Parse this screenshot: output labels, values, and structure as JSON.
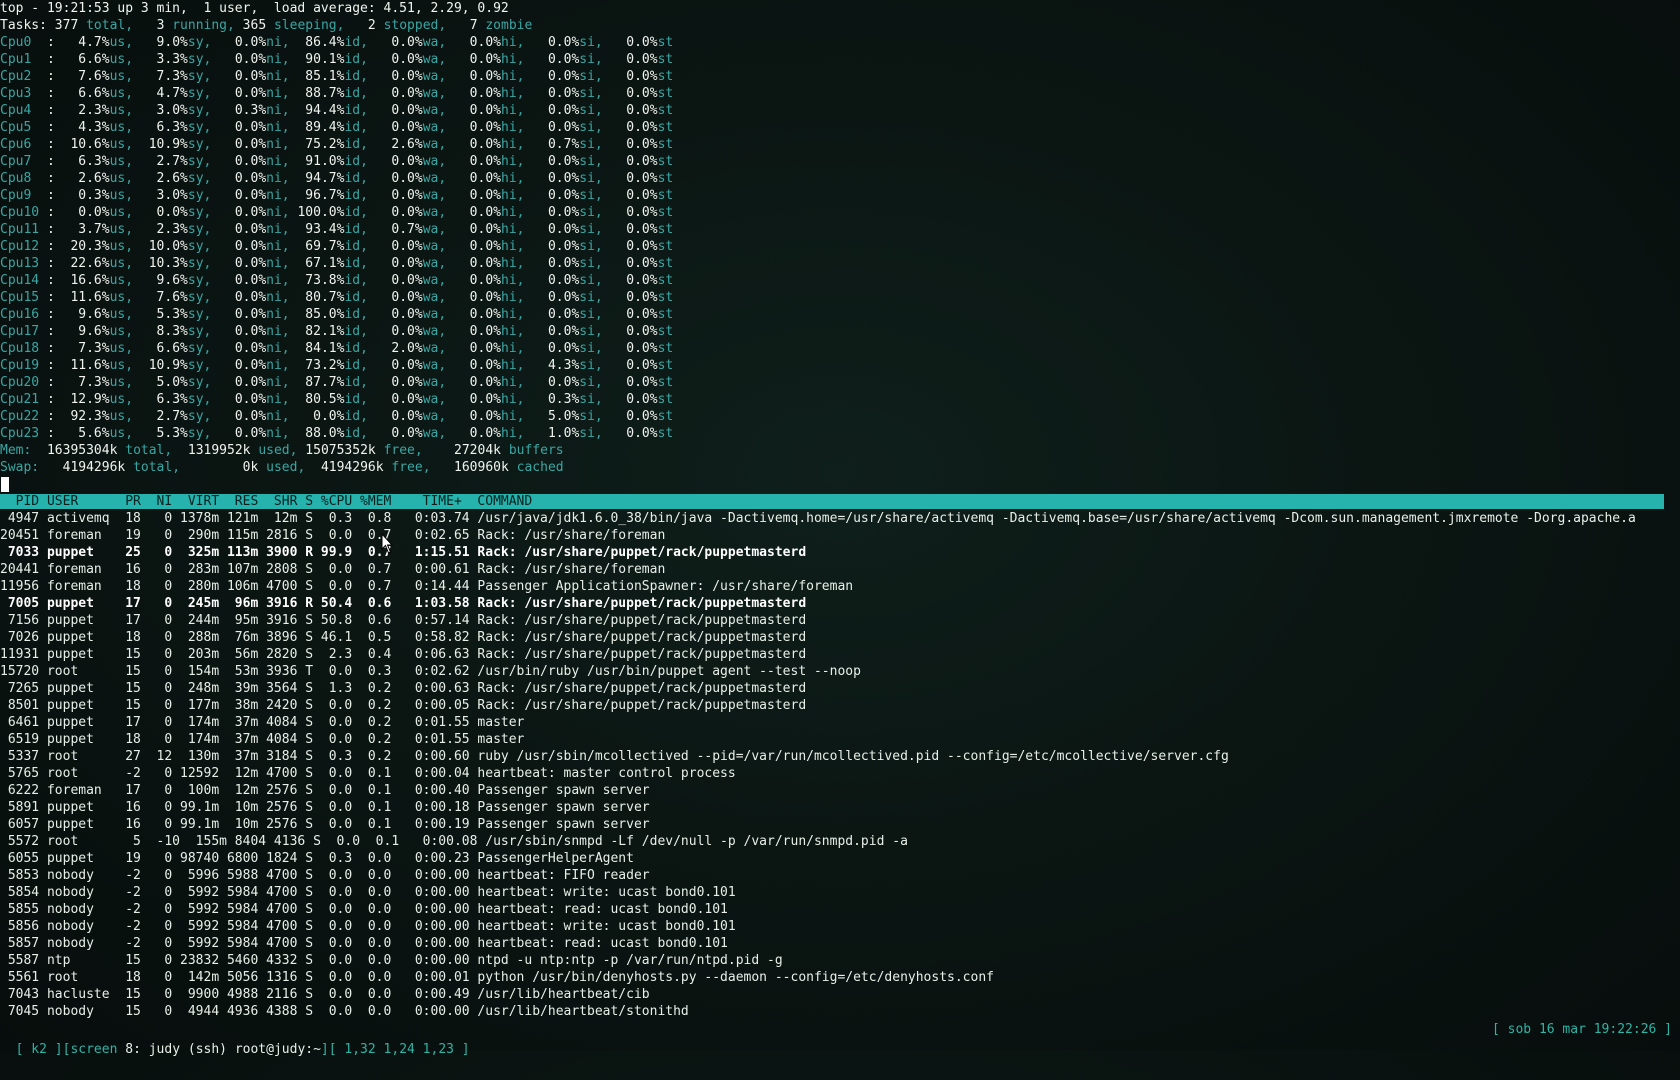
{
  "summary": {
    "top_line": "top - 19:21:53 up 3 min,  1 user,  load average: 4.51, 2.29, 0.92",
    "tasks": {
      "label": "Tasks:",
      "total": "377",
      "total_label": "total,",
      "running": "3",
      "running_label": "running,",
      "sleeping": "365",
      "sleeping_label": "sleeping,",
      "stopped": "2",
      "stopped_label": "stopped,",
      "zombie": "7",
      "zombie_label": "zombie"
    },
    "cpu_field_labels": [
      "us,",
      "sy,",
      "ni,",
      "id,",
      "wa,",
      "hi,",
      "si,",
      "st"
    ],
    "cpus": [
      {
        "name": "Cpu0",
        "us": "4.7%",
        "sy": "9.0%",
        "ni": "0.0%",
        "id": "86.4%",
        "wa": "0.0%",
        "hi": "0.0%",
        "si": "0.0%",
        "st": "0.0%"
      },
      {
        "name": "Cpu1",
        "us": "6.6%",
        "sy": "3.3%",
        "ni": "0.0%",
        "id": "90.1%",
        "wa": "0.0%",
        "hi": "0.0%",
        "si": "0.0%",
        "st": "0.0%"
      },
      {
        "name": "Cpu2",
        "us": "7.6%",
        "sy": "7.3%",
        "ni": "0.0%",
        "id": "85.1%",
        "wa": "0.0%",
        "hi": "0.0%",
        "si": "0.0%",
        "st": "0.0%"
      },
      {
        "name": "Cpu3",
        "us": "6.6%",
        "sy": "4.7%",
        "ni": "0.0%",
        "id": "88.7%",
        "wa": "0.0%",
        "hi": "0.0%",
        "si": "0.0%",
        "st": "0.0%"
      },
      {
        "name": "Cpu4",
        "us": "2.3%",
        "sy": "3.0%",
        "ni": "0.3%",
        "id": "94.4%",
        "wa": "0.0%",
        "hi": "0.0%",
        "si": "0.0%",
        "st": "0.0%"
      },
      {
        "name": "Cpu5",
        "us": "4.3%",
        "sy": "6.3%",
        "ni": "0.0%",
        "id": "89.4%",
        "wa": "0.0%",
        "hi": "0.0%",
        "si": "0.0%",
        "st": "0.0%"
      },
      {
        "name": "Cpu6",
        "us": "10.6%",
        "sy": "10.9%",
        "ni": "0.0%",
        "id": "75.2%",
        "wa": "2.6%",
        "hi": "0.0%",
        "si": "0.7%",
        "st": "0.0%"
      },
      {
        "name": "Cpu7",
        "us": "6.3%",
        "sy": "2.7%",
        "ni": "0.0%",
        "id": "91.0%",
        "wa": "0.0%",
        "hi": "0.0%",
        "si": "0.0%",
        "st": "0.0%"
      },
      {
        "name": "Cpu8",
        "us": "2.6%",
        "sy": "2.6%",
        "ni": "0.0%",
        "id": "94.7%",
        "wa": "0.0%",
        "hi": "0.0%",
        "si": "0.0%",
        "st": "0.0%"
      },
      {
        "name": "Cpu9",
        "us": "0.3%",
        "sy": "3.0%",
        "ni": "0.0%",
        "id": "96.7%",
        "wa": "0.0%",
        "hi": "0.0%",
        "si": "0.0%",
        "st": "0.0%"
      },
      {
        "name": "Cpu10",
        "us": "0.0%",
        "sy": "0.0%",
        "ni": "0.0%",
        "id": "100.0%",
        "wa": "0.0%",
        "hi": "0.0%",
        "si": "0.0%",
        "st": "0.0%"
      },
      {
        "name": "Cpu11",
        "us": "3.7%",
        "sy": "2.3%",
        "ni": "0.0%",
        "id": "93.4%",
        "wa": "0.7%",
        "hi": "0.0%",
        "si": "0.0%",
        "st": "0.0%"
      },
      {
        "name": "Cpu12",
        "us": "20.3%",
        "sy": "10.0%",
        "ni": "0.0%",
        "id": "69.7%",
        "wa": "0.0%",
        "hi": "0.0%",
        "si": "0.0%",
        "st": "0.0%"
      },
      {
        "name": "Cpu13",
        "us": "22.6%",
        "sy": "10.3%",
        "ni": "0.0%",
        "id": "67.1%",
        "wa": "0.0%",
        "hi": "0.0%",
        "si": "0.0%",
        "st": "0.0%"
      },
      {
        "name": "Cpu14",
        "us": "16.6%",
        "sy": "9.6%",
        "ni": "0.0%",
        "id": "73.8%",
        "wa": "0.0%",
        "hi": "0.0%",
        "si": "0.0%",
        "st": "0.0%"
      },
      {
        "name": "Cpu15",
        "us": "11.6%",
        "sy": "7.6%",
        "ni": "0.0%",
        "id": "80.7%",
        "wa": "0.0%",
        "hi": "0.0%",
        "si": "0.0%",
        "st": "0.0%"
      },
      {
        "name": "Cpu16",
        "us": "9.6%",
        "sy": "5.3%",
        "ni": "0.0%",
        "id": "85.0%",
        "wa": "0.0%",
        "hi": "0.0%",
        "si": "0.0%",
        "st": "0.0%"
      },
      {
        "name": "Cpu17",
        "us": "9.6%",
        "sy": "8.3%",
        "ni": "0.0%",
        "id": "82.1%",
        "wa": "0.0%",
        "hi": "0.0%",
        "si": "0.0%",
        "st": "0.0%"
      },
      {
        "name": "Cpu18",
        "us": "7.3%",
        "sy": "6.6%",
        "ni": "0.0%",
        "id": "84.1%",
        "wa": "2.0%",
        "hi": "0.0%",
        "si": "0.0%",
        "st": "0.0%"
      },
      {
        "name": "Cpu19",
        "us": "11.6%",
        "sy": "10.9%",
        "ni": "0.0%",
        "id": "73.2%",
        "wa": "0.0%",
        "hi": "0.0%",
        "si": "4.3%",
        "st": "0.0%"
      },
      {
        "name": "Cpu20",
        "us": "7.3%",
        "sy": "5.0%",
        "ni": "0.0%",
        "id": "87.7%",
        "wa": "0.0%",
        "hi": "0.0%",
        "si": "0.0%",
        "st": "0.0%"
      },
      {
        "name": "Cpu21",
        "us": "12.9%",
        "sy": "6.3%",
        "ni": "0.0%",
        "id": "80.5%",
        "wa": "0.0%",
        "hi": "0.0%",
        "si": "0.3%",
        "st": "0.0%"
      },
      {
        "name": "Cpu22",
        "us": "92.3%",
        "sy": "2.7%",
        "ni": "0.0%",
        "id": "0.0%",
        "wa": "0.0%",
        "hi": "0.0%",
        "si": "5.0%",
        "st": "0.0%"
      },
      {
        "name": "Cpu23",
        "us": "5.6%",
        "sy": "5.3%",
        "ni": "0.0%",
        "id": "88.0%",
        "wa": "0.0%",
        "hi": "0.0%",
        "si": "1.0%",
        "st": "0.0%"
      }
    ],
    "mem": {
      "label": "Mem:",
      "total": "16395304k",
      "total_label": "total,",
      "used": "1319952k",
      "used_label": "used,",
      "free": "15075352k",
      "free_label": "free,",
      "buffers": "27204k",
      "buffers_label": "buffers"
    },
    "swap": {
      "label": "Swap:",
      "total": "4194296k",
      "total_label": "total,",
      "used": "0k",
      "used_label": "used,",
      "free": "4194296k",
      "free_label": "free,",
      "cached": "160960k",
      "cached_label": "cached"
    }
  },
  "columns": [
    "PID",
    "USER",
    "PR",
    "NI",
    "VIRT",
    "RES",
    "SHR",
    "S",
    "%CPU",
    "%MEM",
    "TIME+",
    "COMMAND"
  ],
  "processes": [
    {
      "pid": "4947",
      "user": "activemq",
      "pr": "18",
      "ni": "0",
      "virt": "1378m",
      "res": "121m",
      "shr": "12m",
      "s": "S",
      "cpu": "0.3",
      "mem": "0.8",
      "time": "0:03.74",
      "command": "/usr/java/jdk1.6.0_38/bin/java -Dactivemq.home=/usr/share/activemq -Dactivemq.base=/usr/share/activemq -Dcom.sun.management.jmxremote -Dorg.apache.a",
      "bold": false
    },
    {
      "pid": "20451",
      "user": "foreman",
      "pr": "19",
      "ni": "0",
      "virt": "290m",
      "res": "115m",
      "shr": "2816",
      "s": "S",
      "cpu": "0.0",
      "mem": "0.7",
      "time": "0:02.65",
      "command": "Rack: /usr/share/foreman",
      "bold": false
    },
    {
      "pid": "7033",
      "user": "puppet",
      "pr": "25",
      "ni": "0",
      "virt": "325m",
      "res": "113m",
      "shr": "3900",
      "s": "R",
      "cpu": "99.9",
      "mem": "0.7",
      "time": "1:15.51",
      "command": "Rack: /usr/share/puppet/rack/puppetmasterd",
      "bold": true
    },
    {
      "pid": "20441",
      "user": "foreman",
      "pr": "16",
      "ni": "0",
      "virt": "283m",
      "res": "107m",
      "shr": "2808",
      "s": "S",
      "cpu": "0.0",
      "mem": "0.7",
      "time": "0:00.61",
      "command": "Rack: /usr/share/foreman",
      "bold": false
    },
    {
      "pid": "11956",
      "user": "foreman",
      "pr": "18",
      "ni": "0",
      "virt": "280m",
      "res": "106m",
      "shr": "4700",
      "s": "S",
      "cpu": "0.0",
      "mem": "0.7",
      "time": "0:14.44",
      "command": "Passenger ApplicationSpawner: /usr/share/foreman",
      "bold": false
    },
    {
      "pid": "7005",
      "user": "puppet",
      "pr": "17",
      "ni": "0",
      "virt": "245m",
      "res": "96m",
      "shr": "3916",
      "s": "R",
      "cpu": "50.4",
      "mem": "0.6",
      "time": "1:03.58",
      "command": "Rack: /usr/share/puppet/rack/puppetmasterd",
      "bold": true
    },
    {
      "pid": "7156",
      "user": "puppet",
      "pr": "17",
      "ni": "0",
      "virt": "244m",
      "res": "95m",
      "shr": "3916",
      "s": "S",
      "cpu": "50.8",
      "mem": "0.6",
      "time": "0:57.14",
      "command": "Rack: /usr/share/puppet/rack/puppetmasterd",
      "bold": false
    },
    {
      "pid": "7026",
      "user": "puppet",
      "pr": "18",
      "ni": "0",
      "virt": "288m",
      "res": "76m",
      "shr": "3896",
      "s": "S",
      "cpu": "46.1",
      "mem": "0.5",
      "time": "0:58.82",
      "command": "Rack: /usr/share/puppet/rack/puppetmasterd",
      "bold": false
    },
    {
      "pid": "11931",
      "user": "puppet",
      "pr": "15",
      "ni": "0",
      "virt": "203m",
      "res": "56m",
      "shr": "2820",
      "s": "S",
      "cpu": "2.3",
      "mem": "0.4",
      "time": "0:06.63",
      "command": "Rack: /usr/share/puppet/rack/puppetmasterd",
      "bold": false
    },
    {
      "pid": "15720",
      "user": "root",
      "pr": "15",
      "ni": "0",
      "virt": "154m",
      "res": "53m",
      "shr": "3936",
      "s": "T",
      "cpu": "0.0",
      "mem": "0.3",
      "time": "0:02.62",
      "command": "/usr/bin/ruby /usr/bin/puppet agent --test --noop",
      "bold": false
    },
    {
      "pid": "7265",
      "user": "puppet",
      "pr": "15",
      "ni": "0",
      "virt": "248m",
      "res": "39m",
      "shr": "3564",
      "s": "S",
      "cpu": "1.3",
      "mem": "0.2",
      "time": "0:00.63",
      "command": "Rack: /usr/share/puppet/rack/puppetmasterd",
      "bold": false
    },
    {
      "pid": "8501",
      "user": "puppet",
      "pr": "15",
      "ni": "0",
      "virt": "177m",
      "res": "38m",
      "shr": "2420",
      "s": "S",
      "cpu": "0.0",
      "mem": "0.2",
      "time": "0:00.05",
      "command": "Rack: /usr/share/puppet/rack/puppetmasterd",
      "bold": false
    },
    {
      "pid": "6461",
      "user": "puppet",
      "pr": "17",
      "ni": "0",
      "virt": "174m",
      "res": "37m",
      "shr": "4084",
      "s": "S",
      "cpu": "0.0",
      "mem": "0.2",
      "time": "0:01.55",
      "command": "master",
      "bold": false
    },
    {
      "pid": "6519",
      "user": "puppet",
      "pr": "18",
      "ni": "0",
      "virt": "174m",
      "res": "37m",
      "shr": "4084",
      "s": "S",
      "cpu": "0.0",
      "mem": "0.2",
      "time": "0:01.55",
      "command": "master",
      "bold": false
    },
    {
      "pid": "5337",
      "user": "root",
      "pr": "27",
      "ni": "12",
      "virt": "130m",
      "res": "37m",
      "shr": "3184",
      "s": "S",
      "cpu": "0.3",
      "mem": "0.2",
      "time": "0:00.60",
      "command": "ruby /usr/sbin/mcollectived --pid=/var/run/mcollectived.pid --config=/etc/mcollective/server.cfg",
      "bold": false
    },
    {
      "pid": "5765",
      "user": "root",
      "pr": "-2",
      "ni": "0",
      "virt": "12592",
      "res": "12m",
      "shr": "4700",
      "s": "S",
      "cpu": "0.0",
      "mem": "0.1",
      "time": "0:00.04",
      "command": "heartbeat: master control process",
      "bold": false
    },
    {
      "pid": "6222",
      "user": "foreman",
      "pr": "17",
      "ni": "0",
      "virt": "100m",
      "res": "12m",
      "shr": "2576",
      "s": "S",
      "cpu": "0.0",
      "mem": "0.1",
      "time": "0:00.40",
      "command": "Passenger spawn server",
      "bold": false
    },
    {
      "pid": "5891",
      "user": "puppet",
      "pr": "16",
      "ni": "0",
      "virt": "99.1m",
      "res": "10m",
      "shr": "2576",
      "s": "S",
      "cpu": "0.0",
      "mem": "0.1",
      "time": "0:00.18",
      "command": "Passenger spawn server",
      "bold": false
    },
    {
      "pid": "6057",
      "user": "puppet",
      "pr": "16",
      "ni": "0",
      "virt": "99.1m",
      "res": "10m",
      "shr": "2576",
      "s": "S",
      "cpu": "0.0",
      "mem": "0.1",
      "time": "0:00.19",
      "command": "Passenger spawn server",
      "bold": false
    },
    {
      "pid": "5572",
      "user": "root",
      "pr": "5",
      "ni": "-10",
      "virt": "155m",
      "res": "8404",
      "shr": "4136",
      "s": "S",
      "cpu": "0.0",
      "mem": "0.1",
      "time": "0:00.08",
      "command": "/usr/sbin/snmpd -Lf /dev/null -p /var/run/snmpd.pid -a",
      "bold": false
    },
    {
      "pid": "6055",
      "user": "puppet",
      "pr": "19",
      "ni": "0",
      "virt": "98740",
      "res": "6800",
      "shr": "1824",
      "s": "S",
      "cpu": "0.3",
      "mem": "0.0",
      "time": "0:00.23",
      "command": "PassengerHelperAgent",
      "bold": false
    },
    {
      "pid": "5853",
      "user": "nobody",
      "pr": "-2",
      "ni": "0",
      "virt": "5996",
      "res": "5988",
      "shr": "4700",
      "s": "S",
      "cpu": "0.0",
      "mem": "0.0",
      "time": "0:00.00",
      "command": "heartbeat: FIFO reader",
      "bold": false
    },
    {
      "pid": "5854",
      "user": "nobody",
      "pr": "-2",
      "ni": "0",
      "virt": "5992",
      "res": "5984",
      "shr": "4700",
      "s": "S",
      "cpu": "0.0",
      "mem": "0.0",
      "time": "0:00.00",
      "command": "heartbeat: write: ucast bond0.101",
      "bold": false
    },
    {
      "pid": "5855",
      "user": "nobody",
      "pr": "-2",
      "ni": "0",
      "virt": "5992",
      "res": "5984",
      "shr": "4700",
      "s": "S",
      "cpu": "0.0",
      "mem": "0.0",
      "time": "0:00.00",
      "command": "heartbeat: read: ucast bond0.101",
      "bold": false
    },
    {
      "pid": "5856",
      "user": "nobody",
      "pr": "-2",
      "ni": "0",
      "virt": "5992",
      "res": "5984",
      "shr": "4700",
      "s": "S",
      "cpu": "0.0",
      "mem": "0.0",
      "time": "0:00.00",
      "command": "heartbeat: write: ucast bond0.101",
      "bold": false
    },
    {
      "pid": "5857",
      "user": "nobody",
      "pr": "-2",
      "ni": "0",
      "virt": "5992",
      "res": "5984",
      "shr": "4700",
      "s": "S",
      "cpu": "0.0",
      "mem": "0.0",
      "time": "0:00.00",
      "command": "heartbeat: read: ucast bond0.101",
      "bold": false
    },
    {
      "pid": "5587",
      "user": "ntp",
      "pr": "15",
      "ni": "0",
      "virt": "23832",
      "res": "5460",
      "shr": "4332",
      "s": "S",
      "cpu": "0.0",
      "mem": "0.0",
      "time": "0:00.00",
      "command": "ntpd -u ntp:ntp -p /var/run/ntpd.pid -g",
      "bold": false
    },
    {
      "pid": "5561",
      "user": "root",
      "pr": "18",
      "ni": "0",
      "virt": "142m",
      "res": "5056",
      "shr": "1316",
      "s": "S",
      "cpu": "0.0",
      "mem": "0.0",
      "time": "0:00.01",
      "command": "python /usr/bin/denyhosts.py --daemon --config=/etc/denyhosts.conf",
      "bold": false
    },
    {
      "pid": "7043",
      "user": "hacluste",
      "pr": "15",
      "ni": "0",
      "virt": "9900",
      "res": "4988",
      "shr": "2116",
      "s": "S",
      "cpu": "0.0",
      "mem": "0.0",
      "time": "0:00.49",
      "command": "/usr/lib/heartbeat/cib",
      "bold": false
    },
    {
      "pid": "7045",
      "user": "nobody",
      "pr": "15",
      "ni": "0",
      "virt": "4944",
      "res": "4936",
      "shr": "4388",
      "s": "S",
      "cpu": "0.0",
      "mem": "0.0",
      "time": "0:00.00",
      "command": "/usr/lib/heartbeat/stonithd",
      "bold": false
    }
  ],
  "statusbar": {
    "host_tag": "[ k2 ]",
    "screen_part": "[screen ",
    "window_num": "8:",
    "window_name": " judy (ssh) root@judy:~",
    "window_list": "][ 1,32 1,24 1,23 ]",
    "datetime": "[ sob 16 mar 19:22:26 ]"
  },
  "colors": {
    "accent": "#3aa6a3",
    "header_bar": "#26b2ad",
    "background": "#0b1613"
  }
}
